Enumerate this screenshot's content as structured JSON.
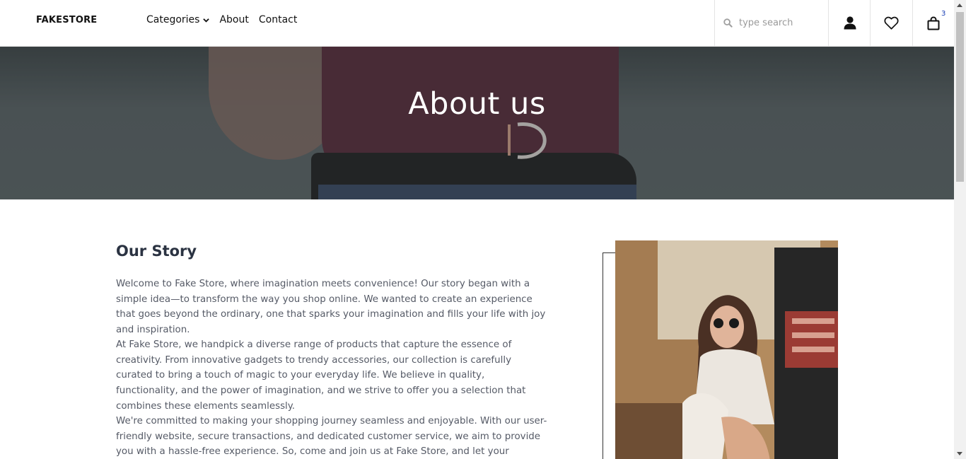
{
  "header": {
    "logo": "FAKESTORE",
    "nav": [
      {
        "label": "Categories"
      },
      {
        "label": "About"
      },
      {
        "label": "Contact"
      }
    ],
    "search": {
      "placeholder": "type search",
      "value": ""
    },
    "cart_count": "3",
    "icons": {
      "user": "user-icon",
      "wishlist": "heart-icon",
      "cart": "bag-icon",
      "search": "search-icon"
    }
  },
  "hero": {
    "title": "About us"
  },
  "story": {
    "title": "Our Story",
    "paragraphs": [
      "Welcome to Fake Store, where imagination meets convenience! Our story began with a simple idea—to transform the way you shop online. We wanted to create an experience that goes beyond the ordinary, one that sparks your imagination and fills your life with joy and inspiration.",
      "At Fake Store, we handpick a diverse range of products that capture the essence of creativity. From innovative gadgets to trendy accessories, our collection is carefully curated to bring a touch of magic to your everyday life. We believe in quality, functionality, and the power of imagination, and we strive to offer you a selection that combines these elements seamlessly.",
      "We're committed to making your shopping journey seamless and enjoyable. With our user-friendly website, secure transactions, and dedicated customer service, we aim to provide you with a hassle-free experience. So, come and join us at Fake Store, and let your imagination run wild as you explore"
    ]
  },
  "colors": {
    "accent_badge": "#1a3fb5",
    "heading": "#2b3342",
    "body_text": "#555a66"
  }
}
